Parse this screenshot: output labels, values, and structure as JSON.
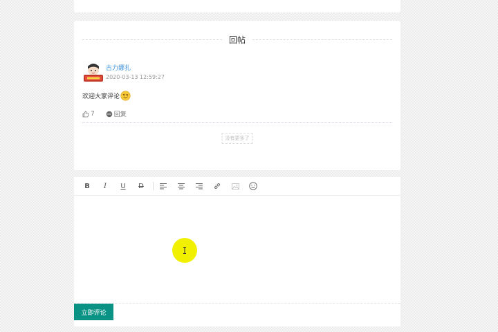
{
  "reply_section": {
    "title": "回帖",
    "reply": {
      "author": "古力娜扎",
      "time": "2020-03-13 12:59:27",
      "content": "欢迎大家评论",
      "likes": "7",
      "reply_label": "回复"
    },
    "no_more": "没有更多了"
  },
  "editor": {
    "toolbar": [
      "bold-icon",
      "italic-icon",
      "underline-icon",
      "strikethrough-icon",
      "align-left-icon",
      "align-center-icon",
      "align-right-icon",
      "link-icon",
      "image-icon",
      "emoji-icon"
    ],
    "bold": "B",
    "italic": "I",
    "underline": "U",
    "strike": "D"
  },
  "submit_label": "立即评论",
  "colors": {
    "accent": "#0a9384",
    "link": "#3a8fd8",
    "cursor_highlight": "#f1f000"
  }
}
